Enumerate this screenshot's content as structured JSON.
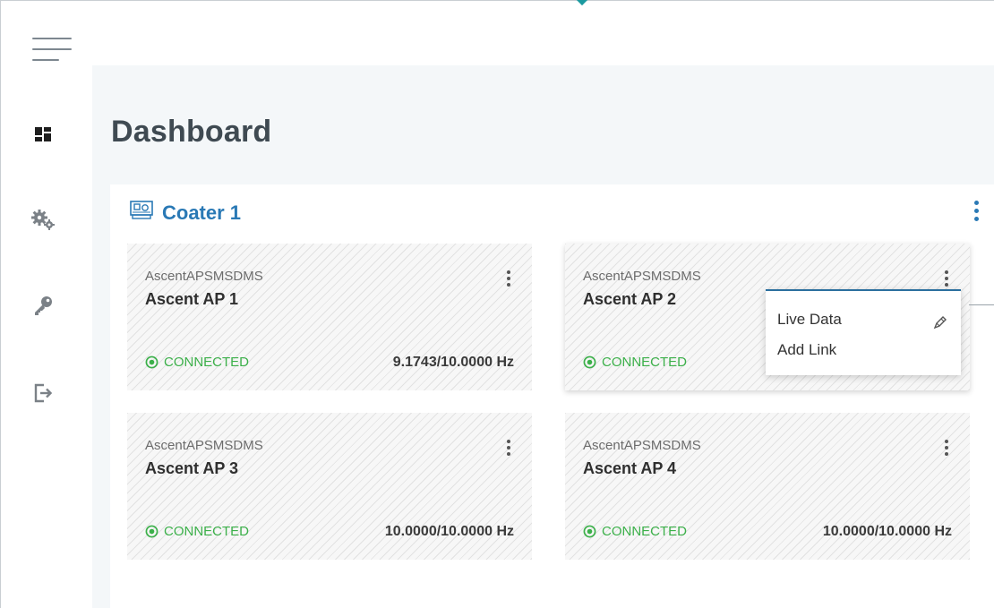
{
  "page_title": "Dashboard",
  "sidebar": {
    "items": [
      {
        "icon": "dashboard-icon"
      },
      {
        "icon": "gears-icon"
      },
      {
        "icon": "key-icon"
      },
      {
        "icon": "logout-icon"
      }
    ]
  },
  "panel": {
    "title": "Coater 1",
    "icon": "machine-icon"
  },
  "cards": [
    {
      "subtitle": "AscentAPSMSDMS",
      "title": "Ascent AP 1",
      "status": "CONNECTED",
      "frequency": "9.1743/10.0000 Hz"
    },
    {
      "subtitle": "AscentAPSMSDMS",
      "title": "Ascent AP 2",
      "status": "CONNECTED",
      "frequency": ""
    },
    {
      "subtitle": "AscentAPSMSDMS",
      "title": "Ascent AP 3",
      "status": "CONNECTED",
      "frequency": "10.0000/10.0000 Hz"
    },
    {
      "subtitle": "AscentAPSMSDMS",
      "title": "Ascent AP 4",
      "status": "CONNECTED",
      "frequency": "10.0000/10.0000 Hz"
    }
  ],
  "context_menu": {
    "items": [
      {
        "label": "Live Data"
      },
      {
        "label": "Add Link"
      }
    ]
  },
  "colors": {
    "accent": "#2a79b5",
    "connected": "#3cb04a",
    "main_bg": "#f4f7f9"
  }
}
